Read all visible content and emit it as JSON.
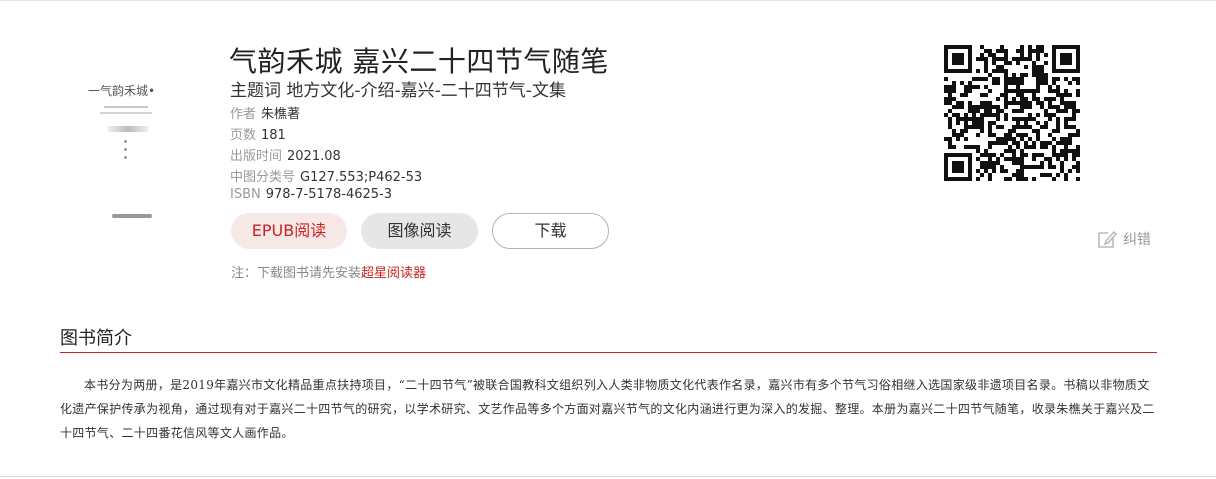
{
  "book": {
    "title": "气韵禾城 嘉兴二十四节气随笔",
    "subject": "主题词 地方文化-介绍-嘉兴-二十四节气-文集",
    "cover_title": "一气韵禾城•",
    "meta": [
      {
        "key": "作者",
        "value": "朱樵著"
      },
      {
        "key": "页数",
        "value": "181"
      },
      {
        "key": "出版时间",
        "value": "2021.08"
      },
      {
        "key": "中图分类号",
        "value": "G127.553;P462-53"
      },
      {
        "key": "ISBN",
        "value": "978-7-5178-4625-3"
      }
    ]
  },
  "actions": {
    "epub_label": "EPUB阅读",
    "image_label": "图像阅读",
    "download_label": "下载"
  },
  "note": {
    "text": "注：下载图书请先安装",
    "link": "超星阅读器"
  },
  "correction": {
    "label": "纠错",
    "icon": "edit-icon"
  },
  "qr_icon": "qr-code-icon",
  "section": {
    "title": "图书简介",
    "description": "本书分为两册，是2019年嘉兴市文化精品重点扶持项目，“二十四节气”被联合国教科文组织列入人类非物质文化代表作名录，嘉兴市有多个节气习俗相继入选国家级非遗项目名录。书稿以非物质文化遗产保护传承为视角，通过现有对于嘉兴二十四节气的研究，以学术研究、文艺作品等多个方面对嘉兴节气的文化内涵进行更为深入的发掘、整理。本册为嘉兴二十四节气随笔，收录朱樵关于嘉兴及二十四节气、二十四番花信风等文人画作品。"
  },
  "colors": {
    "accent": "#cc2222",
    "epub_bg": "#f7e8e8",
    "image_bg": "#e6e6e6",
    "muted": "#999999"
  }
}
